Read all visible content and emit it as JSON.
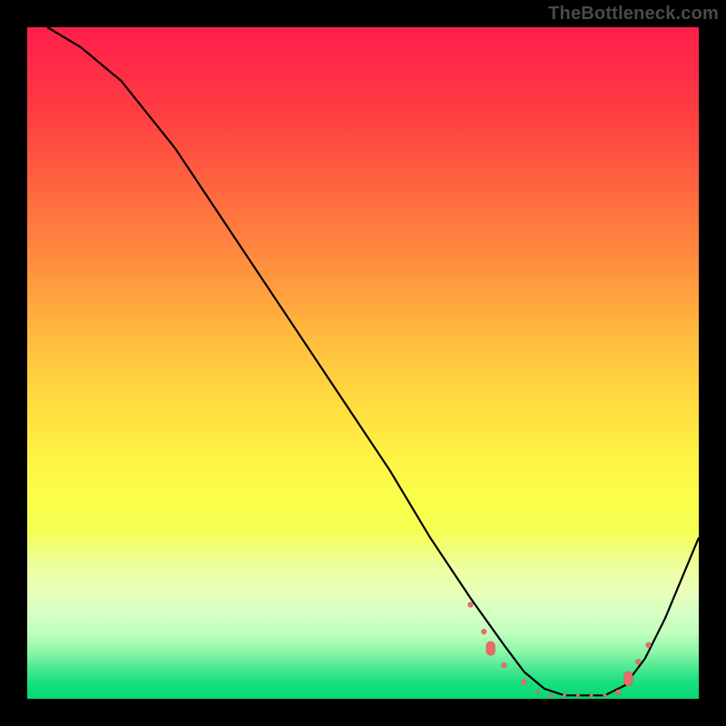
{
  "watermark": "TheBottleneck.com",
  "colors": {
    "watermark": "#4a4a4a",
    "curve": "#000000",
    "marker": "#e96a68",
    "gradient_top": "#ff1f4b",
    "gradient_mid": "#fff043",
    "gradient_bottom": "#06d774",
    "page_bg": "#000000"
  },
  "chart_data": {
    "type": "line",
    "title": "",
    "xlabel": "",
    "ylabel": "",
    "xlim": [
      0,
      100
    ],
    "ylim": [
      0,
      100
    ],
    "grid": false,
    "legend": false,
    "series": [
      {
        "name": "bottleneck-curve",
        "x": [
          3,
          8,
          14,
          22,
          30,
          38,
          46,
          54,
          60,
          66,
          71,
          74,
          77,
          80,
          83,
          86,
          89,
          92,
          95,
          100
        ],
        "y": [
          100,
          97,
          92,
          82,
          70,
          58,
          46,
          34,
          24,
          15,
          8,
          4,
          1.5,
          0.5,
          0.5,
          0.5,
          2,
          6,
          12,
          24
        ]
      }
    ],
    "markers": [
      {
        "x": 66,
        "y": 14,
        "size": "small"
      },
      {
        "x": 68,
        "y": 10,
        "size": "small"
      },
      {
        "x": 69,
        "y": 7.5,
        "size": "large"
      },
      {
        "x": 71,
        "y": 5,
        "size": "small"
      },
      {
        "x": 74,
        "y": 2.5,
        "size": "small"
      },
      {
        "x": 76,
        "y": 1,
        "size": "tiny"
      },
      {
        "x": 78,
        "y": 0.5,
        "size": "tiny"
      },
      {
        "x": 80,
        "y": 0.5,
        "size": "tiny"
      },
      {
        "x": 82,
        "y": 0.5,
        "size": "tiny"
      },
      {
        "x": 84,
        "y": 0.5,
        "size": "tiny"
      },
      {
        "x": 86,
        "y": 0.5,
        "size": "tiny"
      },
      {
        "x": 88,
        "y": 1,
        "size": "small"
      },
      {
        "x": 89.5,
        "y": 3,
        "size": "large"
      },
      {
        "x": 91,
        "y": 5.5,
        "size": "small"
      },
      {
        "x": 92.5,
        "y": 8,
        "size": "small"
      }
    ],
    "marker_sizes": {
      "tiny": 4,
      "small": 6,
      "large": 10
    }
  }
}
